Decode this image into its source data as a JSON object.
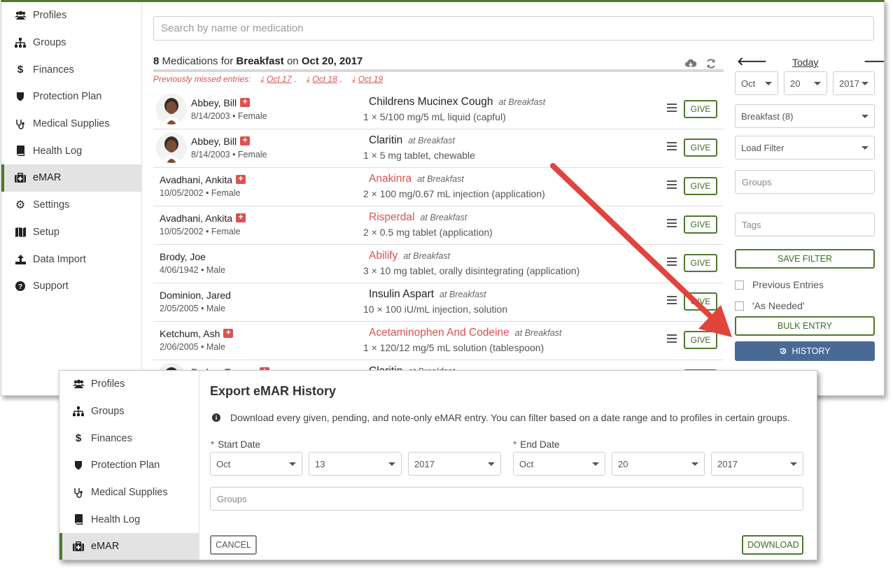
{
  "sidebar": {
    "items": [
      {
        "label": "Profiles",
        "icon": "users-icon"
      },
      {
        "label": "Groups",
        "icon": "sitemap-icon"
      },
      {
        "label": "Finances",
        "icon": "dollar-icon"
      },
      {
        "label": "Protection Plan",
        "icon": "shield-icon"
      },
      {
        "label": "Medical Supplies",
        "icon": "stethoscope-icon"
      },
      {
        "label": "Health Log",
        "icon": "book-icon"
      },
      {
        "label": "eMAR",
        "icon": "medkit-icon",
        "active": true
      },
      {
        "label": "Settings",
        "icon": "gear-icon"
      },
      {
        "label": "Setup",
        "icon": "map-icon"
      },
      {
        "label": "Data Import",
        "icon": "upload-icon"
      },
      {
        "label": "Support",
        "icon": "question-icon"
      }
    ]
  },
  "search": {
    "placeholder": "Search by name or medication"
  },
  "header": {
    "count": "8",
    "mid1": "Medications for",
    "meal": "Breakfast",
    "mid2": "on",
    "date": "Oct 20, 2017"
  },
  "missed": {
    "label": "Previously missed entries:",
    "dates": [
      "Oct 17",
      "Oct 18",
      "Oct 19"
    ],
    "sep": ","
  },
  "rows": [
    {
      "name": "Abbey, Bill",
      "details": "8/14/2003 • Female",
      "avatar": true,
      "alert": true,
      "med": "Childrens Mucinex Cough",
      "time": "at Breakfast",
      "dose": "1 × 5/100 mg/5 mL liquid (capful)",
      "med_alert": false
    },
    {
      "name": "Abbey, Bill",
      "details": "8/14/2003 • Female",
      "avatar": true,
      "alert": true,
      "med": "Claritin",
      "time": "at Breakfast",
      "dose": "1 × 5 mg tablet, chewable",
      "med_alert": false
    },
    {
      "name": "Avadhani, Ankita",
      "details": "10/05/2002 • Female",
      "avatar": false,
      "alert": true,
      "med": "Anakinra",
      "time": "at Breakfast",
      "dose": "2 × 100 mg/0.67 mL injection (application)",
      "med_alert": true
    },
    {
      "name": "Avadhani, Ankita",
      "details": "10/05/2002 • Female",
      "avatar": false,
      "alert": true,
      "med": "Risperdal",
      "time": "at Breakfast",
      "dose": "2 × 0.5 mg tablet (application)",
      "med_alert": true
    },
    {
      "name": "Brody, Joe",
      "details": "4/06/1942 • Male",
      "avatar": false,
      "alert": false,
      "med": "Abilify",
      "time": "at Breakfast",
      "dose": "3 × 10 mg tablet, orally disintegrating (application)",
      "med_alert": true
    },
    {
      "name": "Dominion, Jared",
      "details": "2/05/2005 • Male",
      "avatar": false,
      "alert": false,
      "med": "Insulin Aspart",
      "time": "at Breakfast",
      "dose": "10 × 100 iU/mL injection, solution",
      "med_alert": false
    },
    {
      "name": "Ketchum, Ash",
      "details": "2/06/2005 • Male",
      "avatar": false,
      "alert": true,
      "med": "Acetaminophen And Codeine",
      "time": "at Breakfast",
      "dose": "1 × 120/12 mg/5 mL solution (tablespoon)",
      "med_alert": true
    },
    {
      "name": "Parker, Tommy",
      "details": "",
      "avatar": true,
      "alert": true,
      "med": "Claritin",
      "time": "at Breakfast",
      "dose": "",
      "med_alert": false
    }
  ],
  "give_label": "GIVE",
  "right": {
    "today": "Today",
    "month": "Oct",
    "day": "20",
    "year": "2017",
    "meal_select": "Breakfast (8)",
    "load_filter": "Load Filter",
    "groups_placeholder": "Groups",
    "tags_placeholder": "Tags",
    "save_filter": "SAVE FILTER",
    "previous_entries": "Previous Entries",
    "as_needed": "'As Needed'",
    "bulk_entry": "BULK ENTRY",
    "history": "HISTORY"
  },
  "dialog": {
    "sidebar": [
      {
        "label": "Profiles",
        "icon": "users-icon"
      },
      {
        "label": "Groups",
        "icon": "sitemap-icon"
      },
      {
        "label": "Finances",
        "icon": "dollar-icon"
      },
      {
        "label": "Protection Plan",
        "icon": "shield-icon"
      },
      {
        "label": "Medical Supplies",
        "icon": "stethoscope-icon"
      },
      {
        "label": "Health Log",
        "icon": "book-icon"
      },
      {
        "label": "eMAR",
        "icon": "medkit-icon",
        "active": true
      }
    ],
    "title": "Export eMAR History",
    "info": "Download every given, pending, and note-only eMAR entry. You can filter based on a date range and to profiles in certain groups.",
    "required_mark": "*",
    "start_label": "Start Date",
    "end_label": "End Date",
    "start": {
      "month": "Oct",
      "day": "13",
      "year": "2017"
    },
    "end": {
      "month": "Oct",
      "day": "20",
      "year": "2017"
    },
    "groups_placeholder": "Groups",
    "cancel": "CANCEL",
    "download": "DOWNLOAD"
  },
  "colors": {
    "brand_green": "#4e7a2c",
    "alert_red": "#d9534f",
    "history_blue": "#4a6a96",
    "arrow_red": "#e0443d"
  }
}
